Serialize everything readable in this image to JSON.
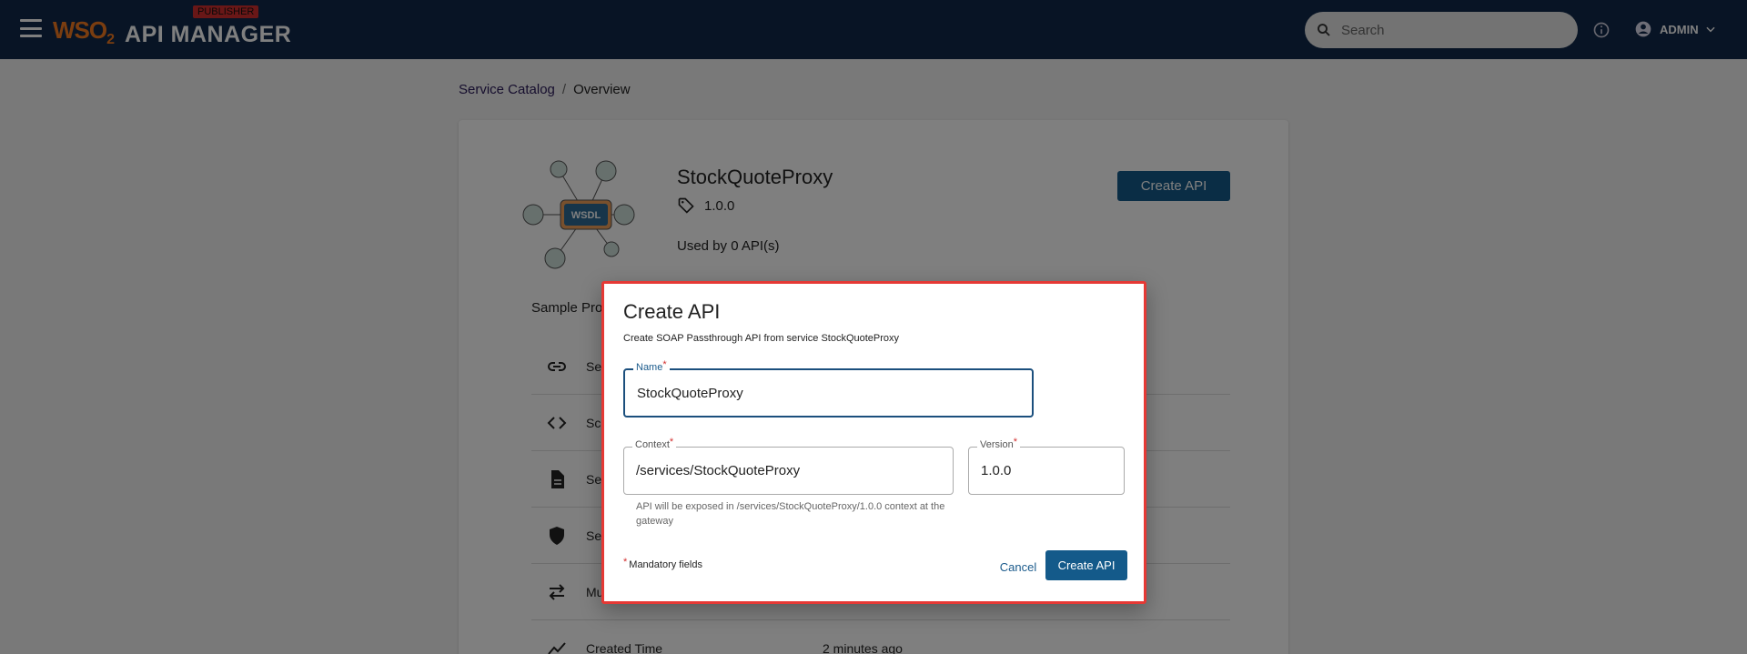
{
  "header": {
    "brand_wso": "WSO",
    "brand_2": "2",
    "brand_name": "API MANAGER",
    "badge": "PUBLISHER",
    "search_placeholder": "Search",
    "user": "ADMIN"
  },
  "breadcrumb": {
    "link": "Service Catalog",
    "separator": "/",
    "current": "Overview"
  },
  "service": {
    "name": "StockQuoteProxy",
    "version": "1.0.0",
    "used_by": "Used by 0 API(s)",
    "create_button": "Create API",
    "description": "Sample Prox",
    "art_label": "WSDL",
    "properties": [
      {
        "icon": "link-icon",
        "label": "Ser",
        "value": ""
      },
      {
        "icon": "code-icon",
        "label": "Sch",
        "value": ""
      },
      {
        "icon": "document-icon",
        "label": "Ser",
        "value": ""
      },
      {
        "icon": "shield-icon",
        "label": "Sec",
        "value": ""
      },
      {
        "icon": "swap-icon",
        "label": "Mu",
        "value": ""
      },
      {
        "icon": "trend-icon",
        "label": "Created Time",
        "value": "2 minutes ago"
      }
    ]
  },
  "dialog": {
    "title": "Create API",
    "subtitle": "Create SOAP Passthrough API from service StockQuoteProxy",
    "name_label": "Name",
    "name_value": "StockQuoteProxy",
    "context_label": "Context",
    "context_value": "/services/StockQuoteProxy",
    "version_label": "Version",
    "version_value": "1.0.0",
    "helper": "API will be exposed in /services/StockQuoteProxy/1.0.0 context at the gateway",
    "required_mark": "*",
    "mandatory": "Mandatory fields",
    "cancel": "Cancel",
    "create": "Create API"
  },
  "colors": {
    "topbar": "#10294a",
    "primary": "#145a8a",
    "highlight_border": "#e53935",
    "brand_orange": "#f47b20"
  }
}
